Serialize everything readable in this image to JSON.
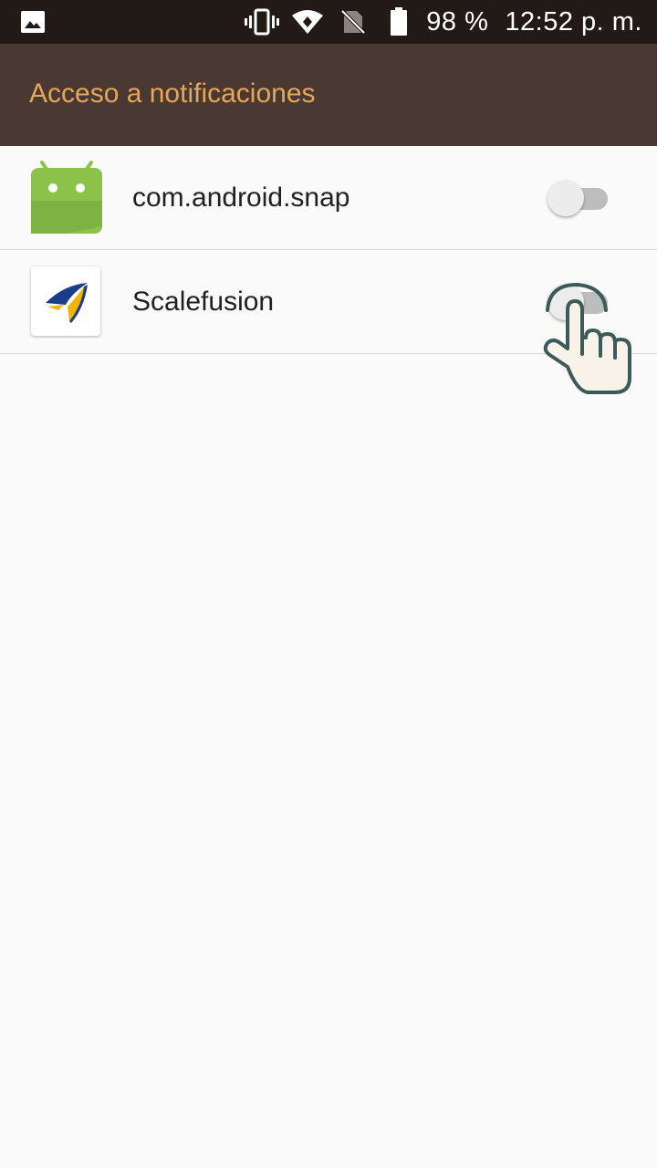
{
  "status_bar": {
    "icons": [
      "image-icon",
      "vibrate-icon",
      "wifi-icon",
      "no-sim-icon",
      "battery-icon"
    ],
    "battery": "98 %",
    "time": "12:52 p. m."
  },
  "app_bar": {
    "title": "Acceso a notificaciones"
  },
  "apps": [
    {
      "name": "com.android.snap",
      "icon": "android-icon",
      "enabled": false
    },
    {
      "name": "Scalefusion",
      "icon": "scalefusion-icon",
      "enabled": false
    }
  ],
  "overlay": {
    "icon": "pointing-hand-icon"
  },
  "colors": {
    "status_bar_bg": "#221a16",
    "app_bar_bg": "#4a3932",
    "title_color": "#e5a55a",
    "background": "#fafafa"
  }
}
